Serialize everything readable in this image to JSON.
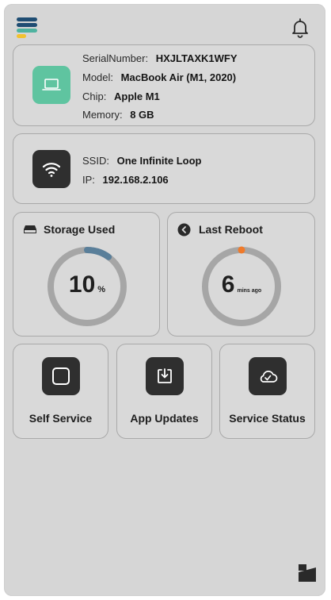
{
  "device": {
    "serial_label": "SerialNumber:",
    "serial_value": "HXJLTAXK1WFY",
    "model_label": "Model:",
    "model_value": "MacBook Air (M1, 2020)",
    "chip_label": "Chip:",
    "chip_value": "Apple M1",
    "memory_label": "Memory:",
    "memory_value": "8 GB",
    "icon": "laptop-icon",
    "icon_bg": "#5fc4a0"
  },
  "network": {
    "ssid_label": "SSID:",
    "ssid_value": "One Infinite Loop",
    "ip_label": "IP:",
    "ip_value": "192.168.2.106",
    "icon": "wifi-icon"
  },
  "storage": {
    "title": "Storage Used",
    "value": "10",
    "unit": "%",
    "fraction": 0.1,
    "accent": "#5a7f9a",
    "icon": "disk-icon"
  },
  "reboot": {
    "title": "Last Reboot",
    "value": "6",
    "unit": "mins ago",
    "marker_color": "#f07a2a",
    "icon": "back-arrow-icon"
  },
  "actions": [
    {
      "label": "Self Service",
      "icon": "square-icon"
    },
    {
      "label": "App Updates",
      "icon": "download-icon"
    },
    {
      "label": "Service Status",
      "icon": "cloud-check-icon"
    }
  ],
  "colors": {
    "menu_blue": "#1f4d73",
    "menu_teal": "#4fb3a0",
    "menu_yellow": "#f2c230"
  }
}
